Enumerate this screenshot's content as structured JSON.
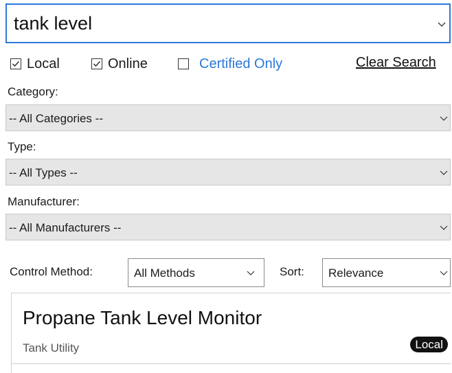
{
  "search": {
    "value": "tank level"
  },
  "filters": {
    "local": {
      "label": "Local",
      "checked": true
    },
    "online": {
      "label": "Online",
      "checked": true
    },
    "certified": {
      "label": "Certified Only",
      "checked": false
    },
    "clear_label": "Clear Search"
  },
  "category": {
    "label": "Category:",
    "selected": "-- All Categories --"
  },
  "type": {
    "label": "Type:",
    "selected": "-- All Types --"
  },
  "manufacturer": {
    "label": "Manufacturer:",
    "selected": "-- All Manufacturers --"
  },
  "control_method": {
    "label": "Control Method:",
    "selected": "All Methods"
  },
  "sort": {
    "label": "Sort:",
    "selected": "Relevance"
  },
  "results": [
    {
      "title": "Propane Tank Level Monitor",
      "subtitle": "Tank Utility",
      "badge": "Local"
    }
  ],
  "colors": {
    "accent": "#2b78d8",
    "dropdown_bg": "#e6e6e6",
    "badge_bg": "#111111"
  }
}
